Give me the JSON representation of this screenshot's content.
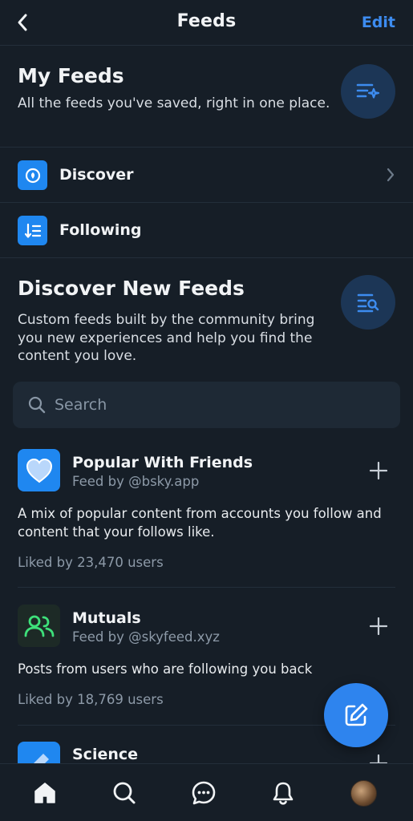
{
  "header": {
    "title": "Feeds",
    "edit_label": "Edit"
  },
  "my_feeds": {
    "title": "My Feeds",
    "description": "All the feeds you've saved, right in one place.",
    "items": [
      {
        "label": "Discover",
        "icon": "discover-icon"
      },
      {
        "label": "Following",
        "icon": "following-icon"
      }
    ]
  },
  "discover": {
    "title": "Discover New Feeds",
    "description": "Custom feeds built by the community bring you new experiences and help you find the content you love."
  },
  "search": {
    "placeholder": "Search"
  },
  "feeds": [
    {
      "name": "Popular With Friends",
      "by": "Feed by @bsky.app",
      "description": "A mix of popular content from accounts you follow and content that your follows like.",
      "likes": "Liked by 23,470 users",
      "icon": "heart-icon"
    },
    {
      "name": "Mutuals",
      "by": "Feed by @skyfeed.xyz",
      "description": "Posts from users who are following you back",
      "likes": "Liked by 18,769 users",
      "icon": "users-icon"
    },
    {
      "name": "Science",
      "icon": "flask-icon"
    }
  ],
  "colors": {
    "accent": "#3d8cf0",
    "background": "#161e27",
    "fab": "#2e84ee"
  },
  "tabbar": [
    "home-icon",
    "search-icon",
    "chat-icon",
    "bell-icon",
    "profile-avatar"
  ]
}
